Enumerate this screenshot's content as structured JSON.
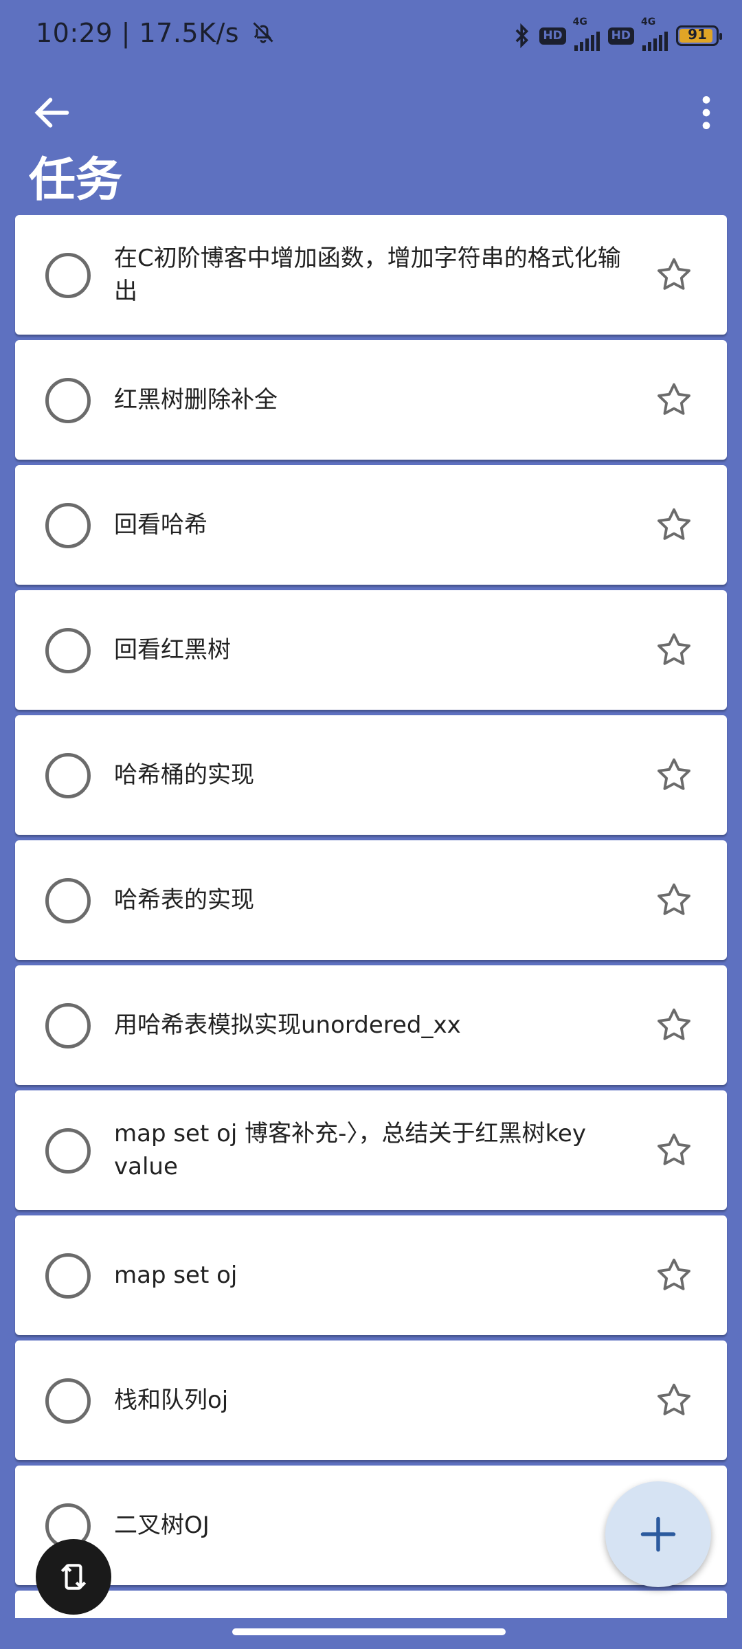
{
  "status_bar": {
    "time": "10:29 | 17.5K/s",
    "net_label": "4G",
    "hd_label": "HD",
    "battery": "91"
  },
  "app_bar": {
    "title": "任务"
  },
  "tasks": [
    {
      "text": "在C初阶博客中增加函数，增加字符串的格式化输出"
    },
    {
      "text": "红黑树删除补全"
    },
    {
      "text": "回看哈希"
    },
    {
      "text": "回看红黑树"
    },
    {
      "text": "哈希桶的实现"
    },
    {
      "text": "哈希表的实现"
    },
    {
      "text": "用哈希表模拟实现unordered_xx"
    },
    {
      "text": "map set oj 博客补充-〉，总结关于红黑树key value"
    },
    {
      "text": "map set oj"
    },
    {
      "text": "栈和队列oj"
    },
    {
      "text": "二叉树OJ"
    }
  ],
  "colors": {
    "background": "#5e71c0",
    "fab": "#d6e3f3",
    "fab_icon": "#2b5a9e"
  },
  "icons": [
    "back-arrow-icon",
    "more-vert-icon",
    "circle-checkbox-icon",
    "star-outline-icon",
    "plus-icon",
    "rotate-icon",
    "bell-off-icon",
    "bluetooth-icon"
  ]
}
